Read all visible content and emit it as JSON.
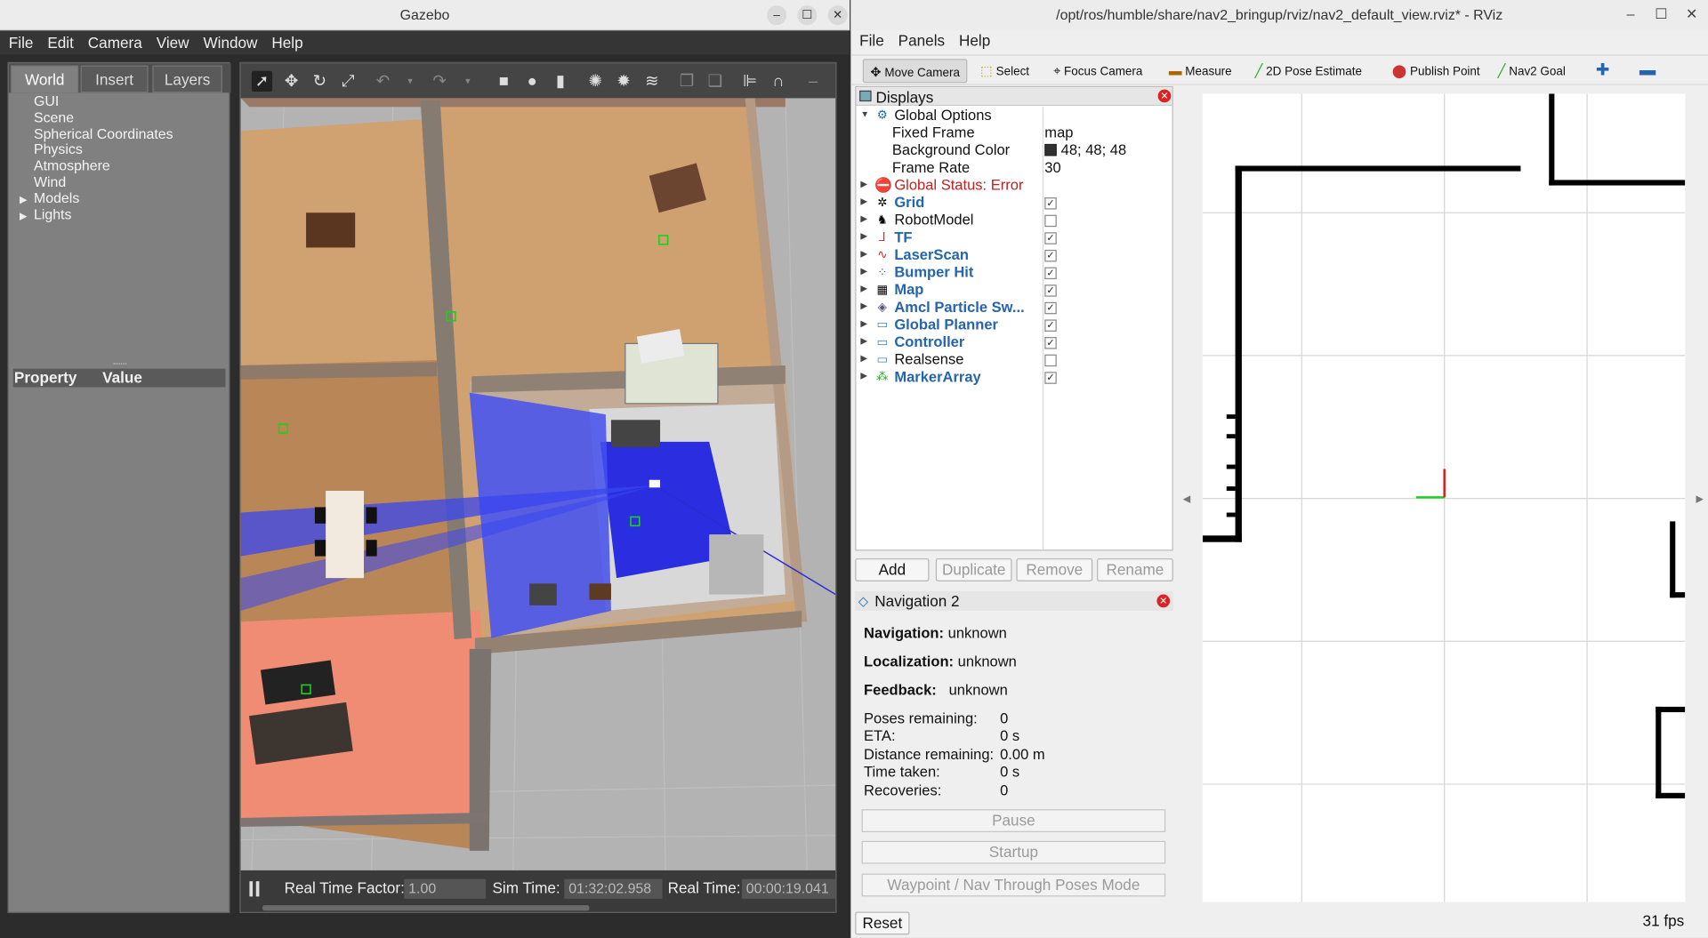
{
  "gazebo": {
    "title": "Gazebo",
    "window_buttons": [
      "–",
      "☐",
      "✕"
    ],
    "menu": [
      "File",
      "Edit",
      "Camera",
      "View",
      "Window",
      "Help"
    ],
    "tabs": [
      "World",
      "Insert",
      "Layers"
    ],
    "tree": [
      "GUI",
      "Scene",
      "Spherical Coordinates",
      "Physics",
      "Atmosphere",
      "Wind",
      "Models",
      "Lights"
    ],
    "property_header": {
      "property": "Property",
      "value": "Value"
    },
    "status": {
      "real_time_factor_label": "Real Time Factor:",
      "real_time_factor": "1.00",
      "sim_time_label": "Sim Time:",
      "sim_time": "01:32:02.958",
      "real_time_label": "Real Time:",
      "real_time": "00:00:19.041"
    }
  },
  "rviz": {
    "title": "/opt/ros/humble/share/nav2_bringup/rviz/nav2_default_view.rviz* - RViz",
    "menu": [
      "File",
      "Panels",
      "Help"
    ],
    "tools": [
      "Move Camera",
      "Select",
      "Focus Camera",
      "Measure",
      "2D Pose Estimate",
      "Publish Point",
      "Nav2 Goal"
    ],
    "displays": {
      "title": "Displays",
      "global_options": "Global Options",
      "fixed_frame_label": "Fixed Frame",
      "fixed_frame": "map",
      "bg_color_label": "Background Color",
      "bg_color": "48; 48; 48",
      "frame_rate_label": "Frame Rate",
      "frame_rate": "30",
      "global_status": "Global Status: Error",
      "items": [
        {
          "name": "Grid",
          "checked": true,
          "bold": true
        },
        {
          "name": "RobotModel",
          "checked": false,
          "bold": false
        },
        {
          "name": "TF",
          "checked": true,
          "bold": true
        },
        {
          "name": "LaserScan",
          "checked": true,
          "bold": true
        },
        {
          "name": "Bumper Hit",
          "checked": true,
          "bold": true
        },
        {
          "name": "Map",
          "checked": true,
          "bold": true
        },
        {
          "name": "Amcl Particle Sw...",
          "checked": true,
          "bold": true
        },
        {
          "name": "Global Planner",
          "checked": true,
          "bold": true
        },
        {
          "name": "Controller",
          "checked": true,
          "bold": true
        },
        {
          "name": "Realsense",
          "checked": false,
          "bold": false
        },
        {
          "name": "MarkerArray",
          "checked": true,
          "bold": true
        }
      ],
      "buttons": [
        "Add",
        "Duplicate",
        "Remove",
        "Rename"
      ]
    },
    "navigation": {
      "title": "Navigation 2",
      "navigation_label": "Navigation:",
      "navigation": "unknown",
      "localization_label": "Localization:",
      "localization": "unknown",
      "feedback_label": "Feedback:",
      "feedback": "unknown",
      "poses_remaining_label": "Poses remaining:",
      "poses_remaining": "0",
      "eta_label": "ETA:",
      "eta": "0 s",
      "distance_label": "Distance remaining:",
      "distance": "0.00 m",
      "time_taken_label": "Time taken:",
      "time_taken": "0 s",
      "recoveries_label": "Recoveries:",
      "recoveries": "0",
      "buttons": [
        "Pause",
        "Startup",
        "Waypoint / Nav Through Poses Mode"
      ]
    },
    "reset": "Reset",
    "fps": "31 fps"
  }
}
